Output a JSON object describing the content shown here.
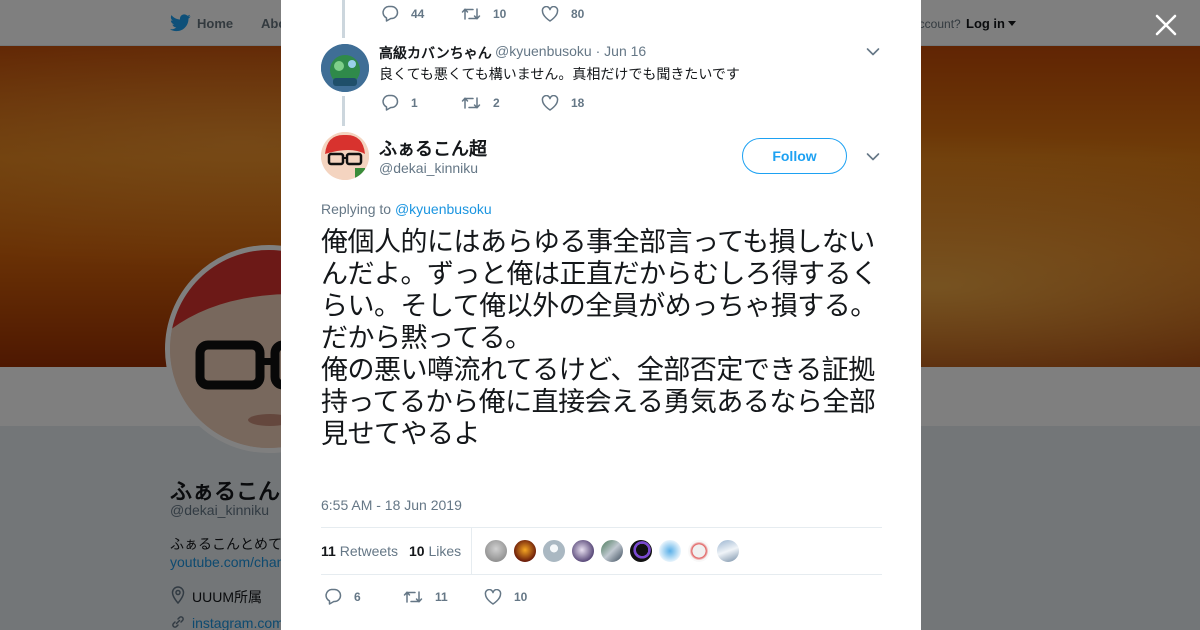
{
  "topnav": {
    "home_label": "Home",
    "about_label": "Abo",
    "account_prompt": "account?",
    "login_label": "Log in"
  },
  "profile": {
    "name": "ふぁるこん",
    "handle": "@dekai_kinniku",
    "bio_start": "ふぁるこんとめて",
    "link": "youtube.com/chan",
    "location": "UUUM所属",
    "instagram": "instagram.com"
  },
  "prev_tweet_actions": {
    "replies": "44",
    "retweets": "10",
    "likes": "80"
  },
  "parent_tweet": {
    "name": "高級カバンちゃん",
    "handle": "@kyuenbusoku · Jun 16",
    "text": "良くても悪くても構いません。真相だけでも聞きたいです",
    "replies": "1",
    "retweets": "2",
    "likes": "18"
  },
  "main_tweet": {
    "name": "ふぁるこん超",
    "handle": "@dekai_kinniku",
    "follow_label": "Follow",
    "replying_prefix": "Replying to ",
    "replying_to": "@kyuenbusoku",
    "text": "俺個人的にはあらゆる事全部言っても損しないんだよ。ずっと俺は正直だからむしろ得するくらい。そして俺以外の全員がめっちゃ損する。\nだから黙ってる。\n俺の悪い噂流れてるけど、全部否定できる証拠持ってるから俺に直接会える勇気あるなら全部見せてやるよ",
    "timestamp": "6:55 AM - 18 Jun 2019",
    "retweet_count": "11",
    "retweet_label": "Retweets",
    "like_count": "10",
    "like_label": "Likes",
    "replies": "6",
    "retweets": "11",
    "likes": "10"
  },
  "colors": {
    "twitter_blue": "#1da1f2",
    "link_blue": "#1b95e0",
    "secondary_text": "#657786",
    "overlay": "rgba(0,0,0,0.5)"
  },
  "icons": [
    "twitter-bird-icon",
    "close-icon",
    "reply-icon",
    "retweet-icon",
    "heart-icon",
    "chevron-down-icon",
    "location-icon",
    "link-icon"
  ]
}
